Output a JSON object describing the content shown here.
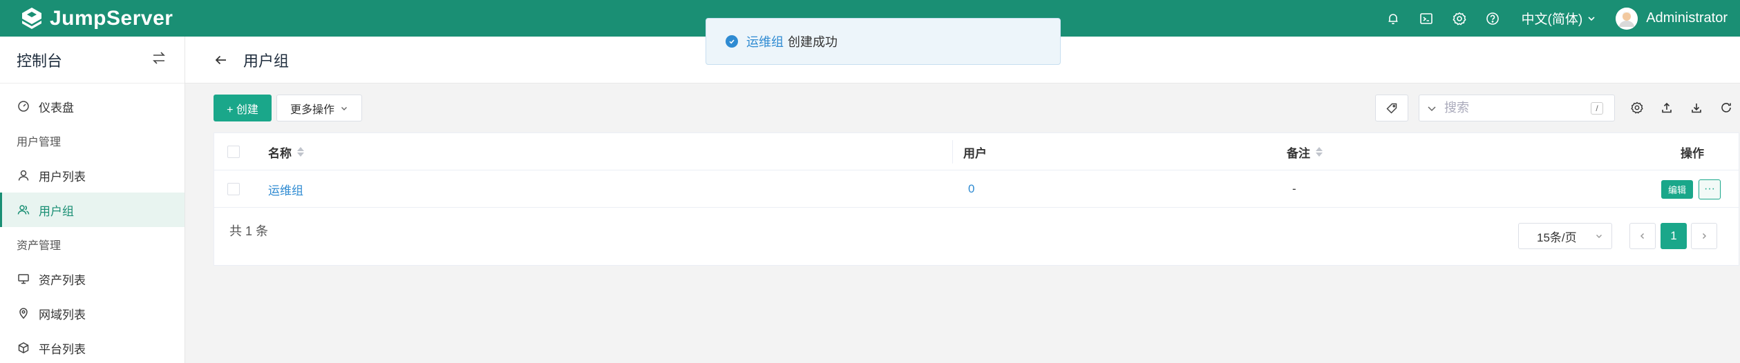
{
  "header": {
    "brand": "JumpServer",
    "language": "中文(简体)",
    "username": "Administrator",
    "icons": [
      "bell-icon",
      "terminal-icon",
      "gear-icon",
      "help-icon"
    ]
  },
  "sidebar": {
    "title": "控制台",
    "items": [
      {
        "type": "item",
        "label": "仪表盘",
        "icon": "dashboard-icon"
      },
      {
        "type": "group",
        "label": "用户管理"
      },
      {
        "type": "item",
        "label": "用户列表",
        "icon": "user-icon"
      },
      {
        "type": "item",
        "label": "用户组",
        "icon": "users-icon",
        "active": true
      },
      {
        "type": "group",
        "label": "资产管理"
      },
      {
        "type": "item",
        "label": "资产列表",
        "icon": "monitor-icon"
      },
      {
        "type": "item",
        "label": "网域列表",
        "icon": "location-icon"
      },
      {
        "type": "item",
        "label": "平台列表",
        "icon": "cube-icon"
      }
    ]
  },
  "page": {
    "title": "用户组"
  },
  "toolbar": {
    "create_label": "+ 创建",
    "more_label": "更多操作",
    "search_placeholder": "搜索",
    "search_shortcut": "/"
  },
  "table": {
    "columns": {
      "name": "名称",
      "users": "用户",
      "comment": "备注",
      "actions": "操作"
    },
    "rows": [
      {
        "name": "运维组",
        "users": "0",
        "comment": "-",
        "edit_label": "编辑",
        "more_label": "···"
      }
    ],
    "total_text": "共 1 条",
    "page_size": "15条/页",
    "current_page": "1"
  },
  "toast": {
    "highlight": "运维组",
    "message": "创建成功"
  },
  "colors": {
    "primary": "#1a8f74",
    "button": "#1aa78a",
    "link": "#2f8bd2"
  }
}
